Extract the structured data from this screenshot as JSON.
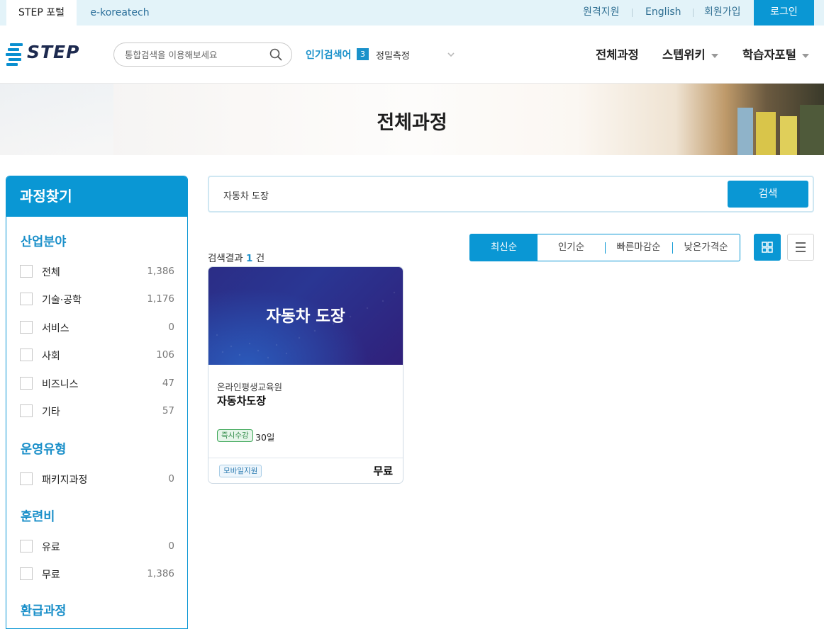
{
  "topbar": {
    "portal_tab": "STEP 포털",
    "ktech_tab": "e-koreatech",
    "remote_support": "원격지원",
    "english": "English",
    "signup": "회원가입",
    "login": "로그인"
  },
  "header": {
    "logo_text": "STEP",
    "search_placeholder": "통합검색을 이용해보세요",
    "popular_label": "인기검색어",
    "popular_rank": "3",
    "popular_term": "정밀측정",
    "nav": [
      "전체과정",
      "스텝위키",
      "학습자포털"
    ]
  },
  "hero": {
    "title": "전체과정"
  },
  "filter": {
    "title": "과정찾기",
    "groups": {
      "industry": "산업분야",
      "operation": "운영유형",
      "fee": "훈련비",
      "refund": "환급과정"
    },
    "industry_items": [
      {
        "label": "전체",
        "count": "1,386"
      },
      {
        "label": "기술·공학",
        "count": "1,176"
      },
      {
        "label": "서비스",
        "count": "0"
      },
      {
        "label": "사회",
        "count": "106"
      },
      {
        "label": "비즈니스",
        "count": "47"
      },
      {
        "label": "기타",
        "count": "57"
      }
    ],
    "operation_items": [
      {
        "label": "패키지과정",
        "count": "0"
      }
    ],
    "fee_items": [
      {
        "label": "유료",
        "count": "0"
      },
      {
        "label": "무료",
        "count": "1,386"
      }
    ]
  },
  "main": {
    "search_value": "자동차 도장",
    "search_button": "검색",
    "result_prefix": "검색결과",
    "result_count": "1",
    "result_suffix": "건",
    "sort_tabs": [
      "최신순",
      "인기순",
      "빠른마감순",
      "낮은가격순"
    ],
    "active_sort": "최신순"
  },
  "card": {
    "thumb_title": "자동차 도장",
    "org": "온라인평생교육원",
    "title": "자동차도장",
    "badge_instant": "즉시수강",
    "days": "30일",
    "badge_mobile": "모바일지원",
    "price": "무료"
  },
  "colors": {
    "accent": "#0a97d4",
    "topbar_bg": "#e3f3f9",
    "group_title": "#1a8fc9"
  }
}
